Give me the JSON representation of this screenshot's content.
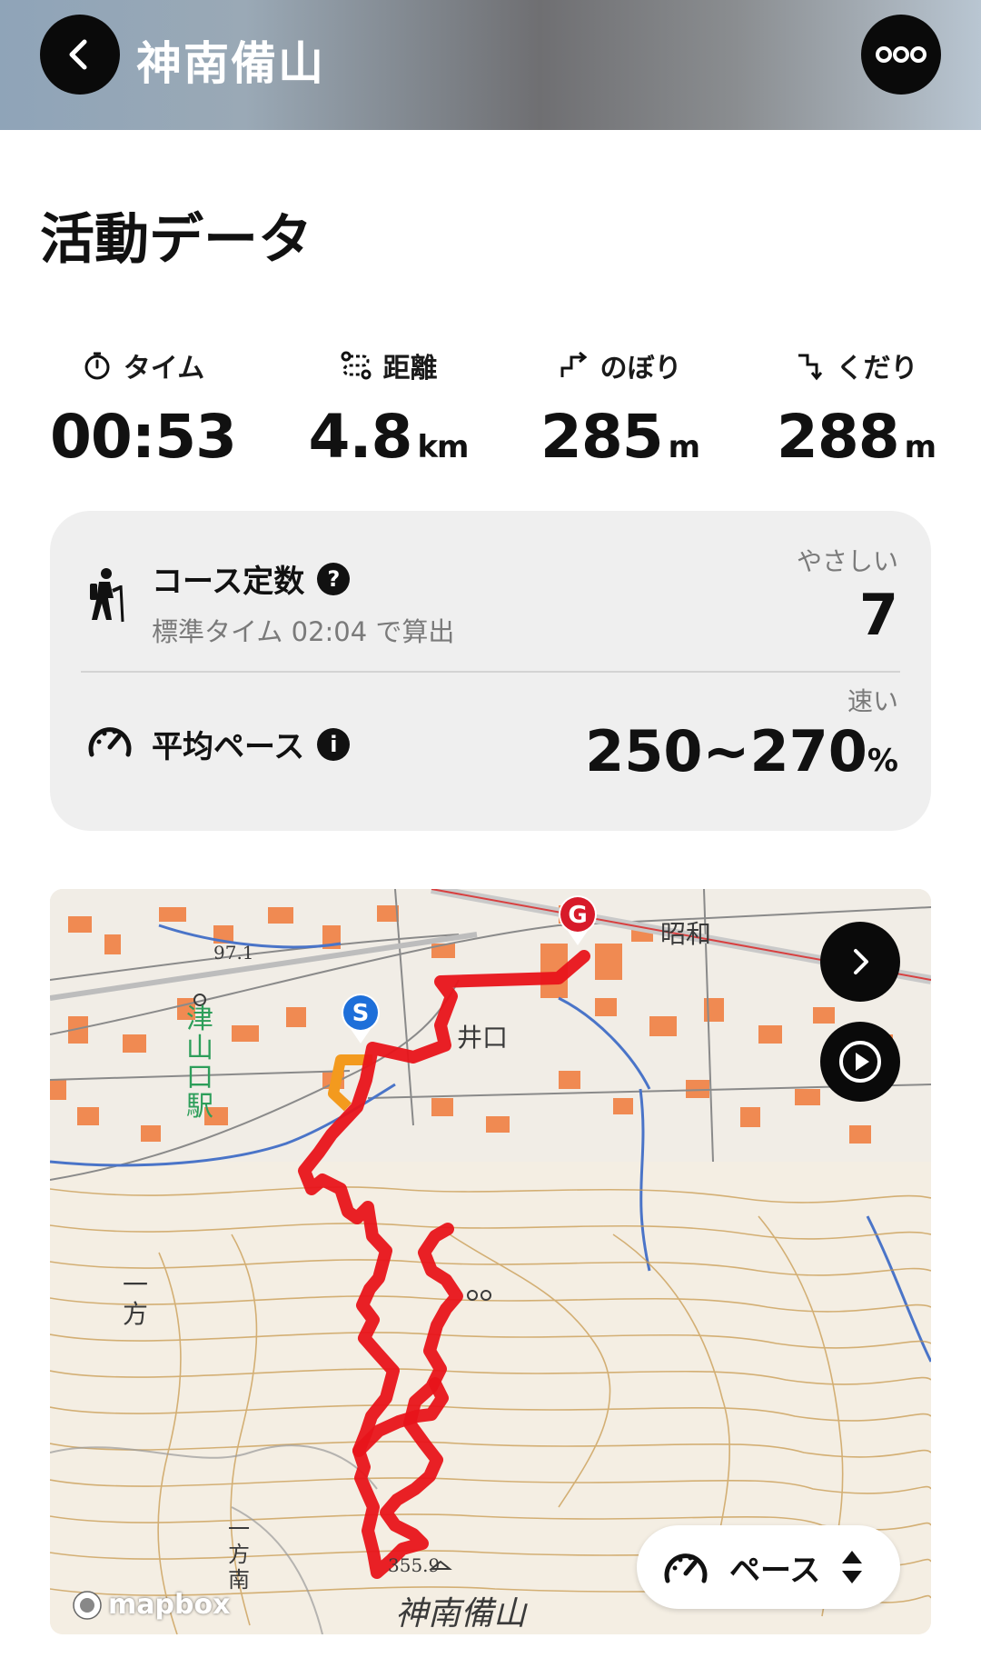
{
  "header": {
    "title": "神南備山",
    "back_icon": "chevron-left-icon",
    "more_icon": "more-horizontal-icon"
  },
  "section": {
    "title": "活動データ"
  },
  "stats": [
    {
      "icon": "stopwatch-icon",
      "label": "タイム",
      "value": "00:53",
      "unit": ""
    },
    {
      "icon": "route-icon",
      "label": "距離",
      "value": "4.8",
      "unit": "km"
    },
    {
      "icon": "ascent-icon",
      "label": "のぼり",
      "value": "285",
      "unit": "m"
    },
    {
      "icon": "descent-icon",
      "label": "くだり",
      "value": "288",
      "unit": "m"
    }
  ],
  "course": {
    "title": "コース定数",
    "subtitle": "標準タイム 02:04 で算出",
    "rating": "やさしい",
    "value": "7"
  },
  "pace": {
    "title": "平均ペース",
    "rating": "速い",
    "value": "250~270",
    "unit": "%"
  },
  "map": {
    "labels": {
      "station": "津山口駅",
      "station_chars": [
        "津",
        "山",
        "口",
        "駅"
      ],
      "area_iguchi": "井口",
      "area_showa": "昭和",
      "area_ippo": "一方",
      "area_ippo_south": "一方南",
      "peak": "神南備山",
      "elevation_peak": "355.9",
      "elevation_low": "97.1"
    },
    "start_marker": "S",
    "goal_marker": "G",
    "pace_button_label": "ペース",
    "attribution": "mapbox",
    "route_color": "#e8141a"
  }
}
